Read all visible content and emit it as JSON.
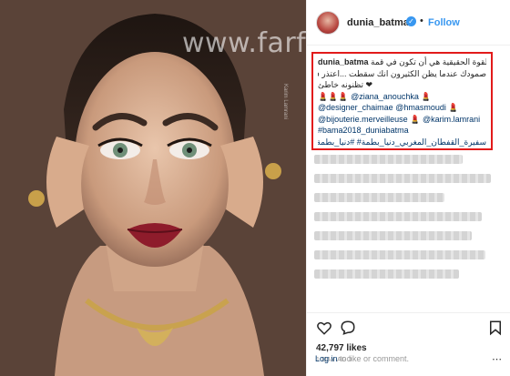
{
  "watermark": "www.farfesh.com",
  "photo": {
    "credit": "Karim Lamrani"
  },
  "header": {
    "username": "dunia_batma",
    "verified_icon": "verified-badge-icon",
    "separator": "•",
    "follow_label": "Follow"
  },
  "caption": {
    "username": "dunia_batma",
    "line1": "القوة الحقيقية هي أن تكون في قمة",
    "line2": "صمودك عندما يظن الكثيرون انك سقطت ...اعتذر فما",
    "line3": "❤ تظنونه خاطئ",
    "line4_prefix": "💄💄💄",
    "line4_mention": "@ziana_anouchka",
    "line4_suffix": "💄",
    "line5_mention": "@designer_chaimae",
    "line5_mention2": "@hmasmoudi",
    "line5_suffix": "💄",
    "line6_mention": "@bijouterie.merveilleuse",
    "line6_mid": "💄",
    "line6_mention2": "@karim.lamrani",
    "line7_tag": "#bama2018_duniabatma",
    "line8_tags": "سفيرة_القفطان_المغربي_دنيا_بطمة# #دنيا_بطمة#"
  },
  "actions": {
    "heart_icon": "heart-icon",
    "comment_icon": "comment-icon",
    "bookmark_icon": "bookmark-icon"
  },
  "likes": "42,797 likes",
  "time_ago": "1 DAY AGO",
  "login": {
    "link_label": "Log in",
    "text": " to like or comment.",
    "more_label": "⋯"
  }
}
